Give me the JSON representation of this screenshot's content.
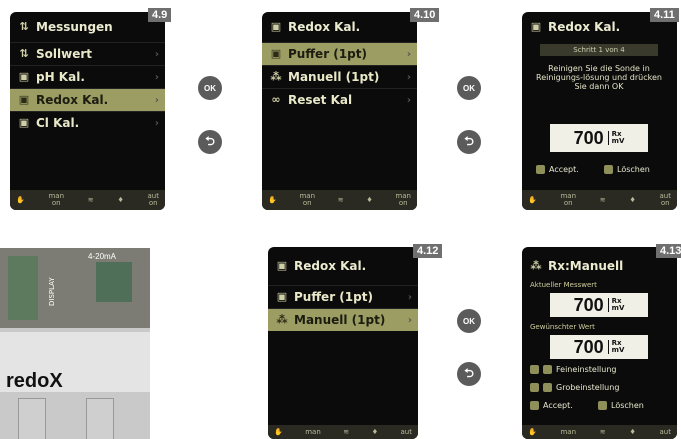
{
  "panels": {
    "p49": {
      "tag": "4.9",
      "title": "Messungen",
      "items": [
        "Sollwert",
        "pH Kal.",
        "Redox Kal.",
        "Cl Kal."
      ],
      "selected": 2,
      "footer": [
        "man\non",
        "",
        "",
        "aut\non"
      ]
    },
    "p410": {
      "tag": "4.10",
      "title": "Redox Kal.",
      "items": [
        "Puffer (1pt)",
        "Manuell (1pt)",
        "Reset Kal"
      ],
      "selected": 0,
      "footer": [
        "man\non",
        "",
        "",
        "man\non"
      ]
    },
    "p411": {
      "tag": "4.11",
      "title": "Redox Kal.",
      "step": "Schritt 1 von 4",
      "message": "Reinigen Sie die Sonde in Reinigungs-lösung und drücken Sie dann OK",
      "value": "700",
      "unit_top": "Rx",
      "unit_bottom": "mV",
      "accept": "Accept.",
      "delete": "Löschen",
      "footer": [
        "man\non",
        "",
        "",
        "aut\non"
      ]
    },
    "p412": {
      "tag": "4.12",
      "title": "Redox Kal.",
      "items": [
        "Puffer (1pt)",
        "Manuell (1pt)"
      ],
      "selected": 1,
      "footer": [
        "man",
        "",
        "",
        "aut"
      ]
    },
    "p413": {
      "tag": "4.13",
      "title": "Rx:Manuell",
      "current_label": "Aktueller Messwert",
      "current_value": "700",
      "desired_label": "Gewünschter Wert",
      "desired_value": "700",
      "unit_top": "Rx",
      "unit_bottom": "mV",
      "fine": "Feineinstellung",
      "coarse": "Grobeinstellung",
      "accept": "Accept.",
      "delete": "Löschen",
      "footer": [
        "man",
        "",
        "",
        "aut"
      ]
    }
  },
  "buttons": {
    "ok": "OK",
    "back": "⮌"
  },
  "photo": {
    "label": "redoX",
    "connector": "4-20mA",
    "display": "DISPLAY"
  },
  "colors": {
    "highlight": "#9c9d63",
    "screen_bg": "#0b0b0b",
    "tag_bg": "#6f6f6f"
  }
}
